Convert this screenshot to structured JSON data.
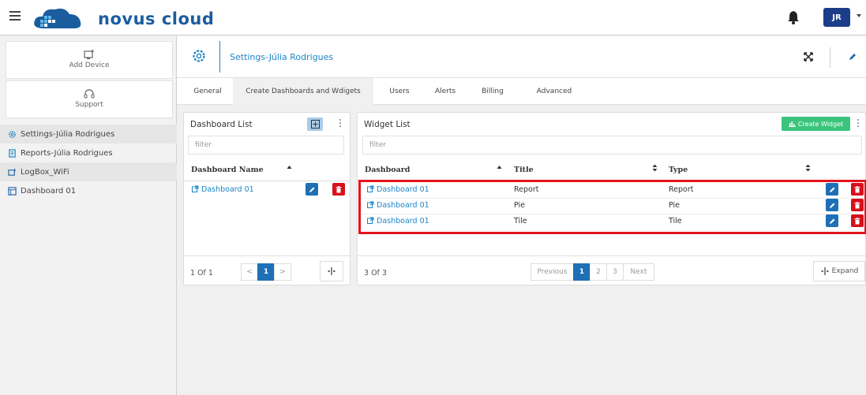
{
  "topbar": {
    "logo_text": "novus cloud",
    "user_initials": "JR"
  },
  "sidebar": {
    "add_device": "Add Device",
    "support": "Support",
    "items": [
      {
        "label": "Settings-Júlia Rodrigues"
      },
      {
        "label": "Reports-Júlia Rodrigues"
      },
      {
        "label": "LogBox_WiFi"
      },
      {
        "label": "Dashboard 01"
      }
    ]
  },
  "header": {
    "title": "Settings-Júlia Rodrigues"
  },
  "tabs": [
    {
      "label": "General"
    },
    {
      "label": "Create Dashboards and Wdigets"
    },
    {
      "label": "Users"
    },
    {
      "label": "Alerts"
    },
    {
      "label": "Billing"
    },
    {
      "label": "Advanced"
    }
  ],
  "dashboard_list": {
    "title": "Dashboard List",
    "filter_placeholder": "filter",
    "column": "Dashboard Name",
    "rows": [
      {
        "name": "Dashboard 01"
      }
    ],
    "page_info": "1 Of 1",
    "prev": "<",
    "page": "1",
    "next": ">"
  },
  "widget_list": {
    "title": "Widget List",
    "create_label": "Create Widget",
    "filter_placeholder": "filter",
    "columns": {
      "dashboard": "Dashboard",
      "title": "Title",
      "type": "Type"
    },
    "rows": [
      {
        "dashboard": "Dashboard 01",
        "title": "Report",
        "type": "Report"
      },
      {
        "dashboard": "Dashboard 01",
        "title": "Pie",
        "type": "Pie"
      },
      {
        "dashboard": "Dashboard 01",
        "title": "Tile",
        "type": "Tile"
      }
    ],
    "page_info": "3 Of 3",
    "previous": "Previous",
    "pages": [
      "1",
      "2",
      "3"
    ],
    "next": "Next",
    "expand": "Expand"
  },
  "colors": {
    "brand": "#1b5c9e",
    "accent": "#1b86c6",
    "edit": "#1f6fb5",
    "delete": "#d7101b",
    "create": "#3cc47c",
    "highlight": "#e3141c"
  }
}
